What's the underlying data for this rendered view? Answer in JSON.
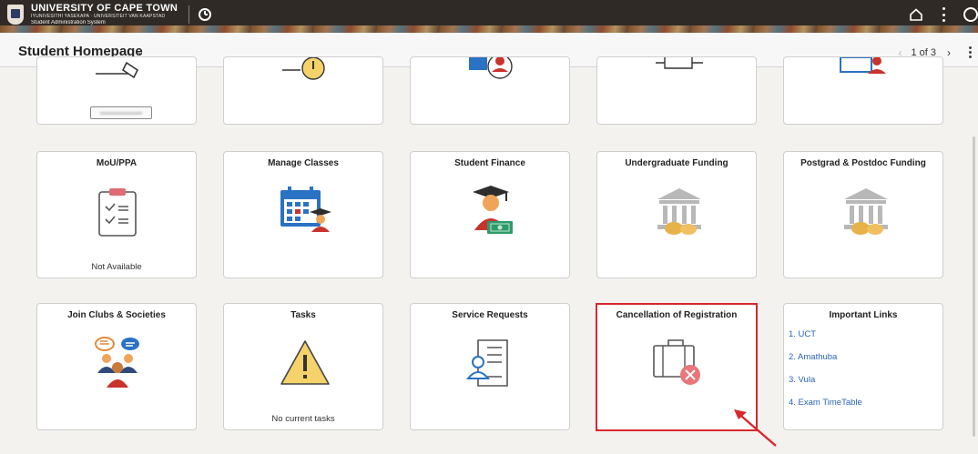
{
  "header": {
    "university_name": "UNIVERSITY OF CAPE TOWN",
    "university_translations": "IYUNIVESITHI YASEKAPA · UNIVERSITEIT VAN KAAPSTAD",
    "system_name": "Student Administration System",
    "icons": [
      "clock-icon",
      "home-icon",
      "kebab-icon",
      "compass-icon"
    ]
  },
  "subheader": {
    "title": "Student Homepage",
    "title_chevron": "⌄",
    "pager": {
      "text": "1 of 3",
      "prev": "‹",
      "next": "›"
    }
  },
  "tiles": {
    "row0": [
      {
        "title": "",
        "icon": "pencil-icon"
      },
      {
        "title": "",
        "icon": "alert-icon"
      },
      {
        "title": "",
        "icon": "profile-icon"
      },
      {
        "title": "",
        "icon": "monitor-icon"
      },
      {
        "title": "",
        "icon": "card-user-icon"
      }
    ],
    "mou": {
      "title": "MoU/PPA",
      "footer": "Not Available",
      "icon": "checklist-icon"
    },
    "manage_classes": {
      "title": "Manage Classes",
      "icon": "calendar-student-icon"
    },
    "student_finance": {
      "title": "Student Finance",
      "icon": "graduate-money-icon"
    },
    "ug_funding": {
      "title": "Undergraduate Funding",
      "icon": "bank-icon"
    },
    "pg_funding": {
      "title": "Postgrad & Postdoc Funding",
      "icon": "bank-icon"
    },
    "clubs": {
      "title": "Join Clubs & Societies",
      "icon": "people-chat-icon"
    },
    "tasks": {
      "title": "Tasks",
      "footer": "No current tasks",
      "icon": "warning-icon"
    },
    "service_requests": {
      "title": "Service Requests",
      "icon": "document-user-icon"
    },
    "cancellation": {
      "title": "Cancellation of Registration",
      "icon": "briefcase-cancel-icon"
    },
    "important_links": {
      "title": "Important Links",
      "links": [
        "1. UCT",
        "2. Amathuba",
        "3. Vula",
        "4. Exam TimeTable"
      ]
    }
  },
  "colors": {
    "header_bg": "#2f2a26",
    "highlight": "#d9272e",
    "link": "#2a66b2",
    "accent_red": "#c8332c",
    "accent_blue": "#2a72c4"
  }
}
